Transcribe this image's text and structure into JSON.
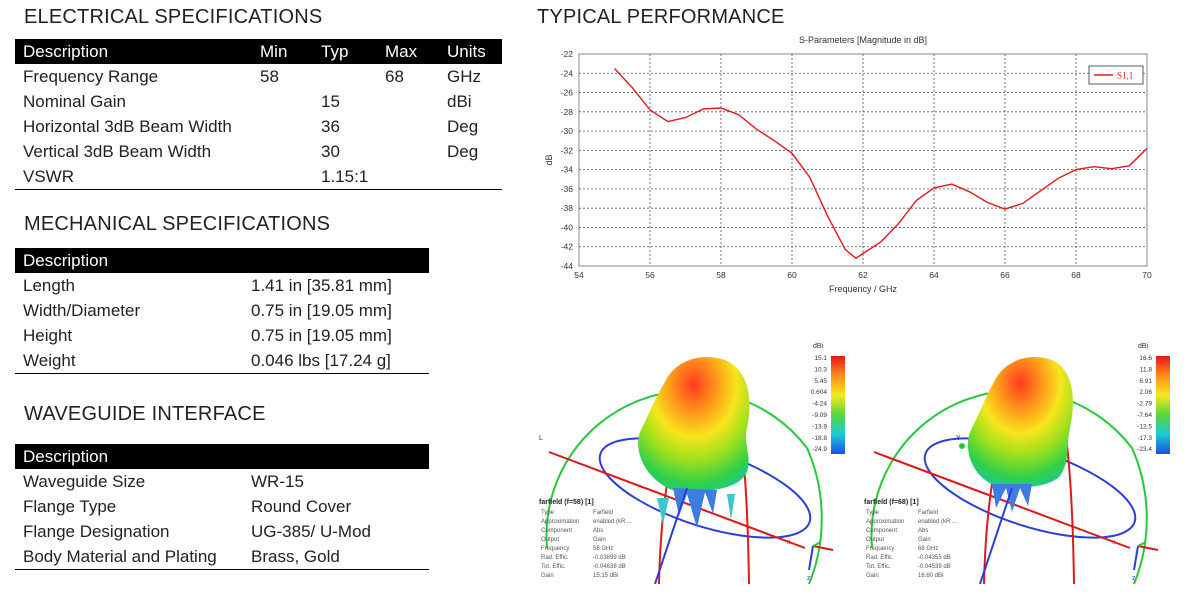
{
  "electrical": {
    "title": "ELECTRICAL SPECIFICATIONS",
    "headers": [
      "Description",
      "Min",
      "Typ",
      "Max",
      "Units"
    ],
    "rows": [
      [
        "Frequency Range",
        "58",
        "",
        "68",
        "GHz"
      ],
      [
        "Nominal Gain",
        "",
        "15",
        "",
        "dBi"
      ],
      [
        "Horizontal 3dB Beam Width",
        "",
        "36",
        "",
        "Deg"
      ],
      [
        "Vertical 3dB Beam Width",
        "",
        "30",
        "",
        "Deg"
      ],
      [
        "VSWR",
        "",
        "1.15:1",
        "",
        ""
      ]
    ]
  },
  "mechanical": {
    "title": "MECHANICAL SPECIFICATIONS",
    "header": "Description",
    "rows": [
      [
        "Length",
        "1.41 in [35.81 mm]"
      ],
      [
        "Width/Diameter",
        "0.75 in [19.05 mm]"
      ],
      [
        "Height",
        "0.75 in [19.05 mm]"
      ],
      [
        "Weight",
        "0.046 lbs [17.24 g]"
      ]
    ]
  },
  "waveguide": {
    "title": "WAVEGUIDE INTERFACE",
    "header": "Description",
    "rows": [
      [
        "Waveguide Size",
        "WR-15"
      ],
      [
        "Flange Type",
        "Round Cover"
      ],
      [
        "Flange Designation",
        "UG-385/ U-Mod"
      ],
      [
        "Body Material and Plating",
        "Brass, Gold"
      ]
    ]
  },
  "performance_title": "TYPICAL PERFORMANCE",
  "chart_data": {
    "type": "line",
    "title": "S-Parameters [Magnitude in dB]",
    "xlabel": "Frequency / GHz",
    "ylabel": "dB",
    "xlim": [
      54,
      70
    ],
    "ylim": [
      -44,
      -22
    ],
    "xticks": [
      54,
      56,
      58,
      60,
      62,
      64,
      66,
      68,
      70
    ],
    "yticks": [
      -22,
      -24,
      -26,
      -28,
      -30,
      -32,
      -34,
      -36,
      -38,
      -40,
      -42,
      -44
    ],
    "grid": true,
    "legend_position": "top-right",
    "series": [
      {
        "name": "S1,1",
        "color": "#e8161b",
        "x": [
          55.0,
          55.5,
          56.0,
          56.5,
          57.0,
          57.5,
          58.0,
          58.5,
          59.0,
          59.5,
          60.0,
          60.5,
          61.0,
          61.5,
          61.8,
          62.0,
          62.5,
          63.0,
          63.5,
          64.0,
          64.5,
          65.0,
          65.5,
          66.0,
          66.5,
          67.0,
          67.5,
          68.0,
          68.5,
          69.0,
          69.5,
          70.0
        ],
        "y": [
          -23.5,
          -25.5,
          -27.8,
          -29.0,
          -28.6,
          -27.7,
          -27.6,
          -28.3,
          -29.8,
          -31.0,
          -32.3,
          -34.8,
          -38.8,
          -42.3,
          -43.2,
          -42.7,
          -41.5,
          -39.6,
          -37.2,
          -35.9,
          -35.5,
          -36.3,
          -37.4,
          -38.1,
          -37.5,
          -36.2,
          -34.9,
          -34.0,
          -33.7,
          -33.9,
          -33.6,
          -31.8
        ]
      }
    ]
  },
  "patterns": [
    {
      "unit": "dBi",
      "scale": [
        "15.1",
        "10.3",
        "5.45",
        "0.604",
        "-4.24",
        "-9.09",
        "-13.9",
        "-18.8",
        "-24.9"
      ],
      "info_title": "farfield (f=58) [1]",
      "info_rows": [
        [
          "Type",
          "Farfield"
        ],
        [
          "Approximation",
          "enabled (kR ..."
        ],
        [
          "Component",
          "Abs"
        ],
        [
          "Output",
          "Gain"
        ],
        [
          "Frequency",
          "58 GHz"
        ],
        [
          "Rad. Effic.",
          "-0.03899 dB"
        ],
        [
          "Tot. Effic.",
          "-0.04638 dB"
        ],
        [
          "Gain",
          "15.15 dBi"
        ]
      ]
    },
    {
      "unit": "dBi",
      "scale": [
        "16.6",
        "11.8",
        "6.91",
        "2.06",
        "-2.79",
        "-7.64",
        "-12.5",
        "-17.3",
        "-23.4"
      ],
      "info_title": "farfield (f=68) [1]",
      "info_rows": [
        [
          "Type",
          "Farfield"
        ],
        [
          "Approximation",
          "enabled (kR ..."
        ],
        [
          "Component",
          "Abs"
        ],
        [
          "Output",
          "Gain"
        ],
        [
          "Frequency",
          "68 GHz"
        ],
        [
          "Rad. Effic.",
          "-0.04355 dB"
        ],
        [
          "Tot. Effic.",
          "-0.04539 dB"
        ],
        [
          "Gain",
          "16.60 dBi"
        ]
      ]
    }
  ]
}
